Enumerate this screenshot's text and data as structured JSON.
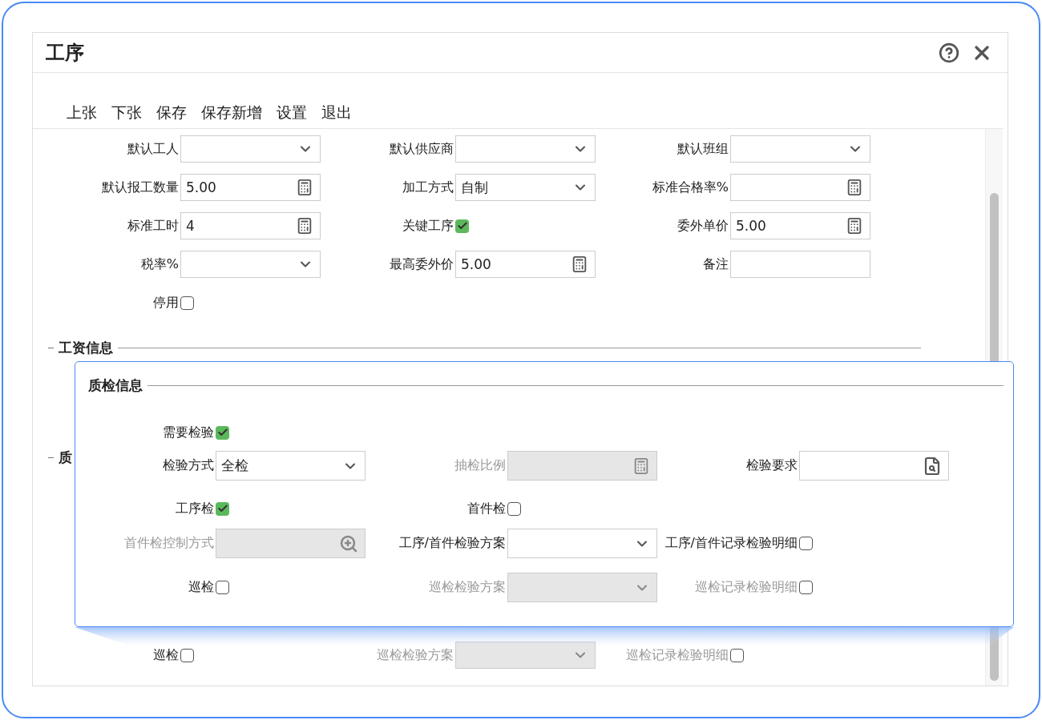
{
  "window": {
    "title": "工序"
  },
  "toolbar": [
    "上张",
    "下张",
    "保存",
    "保存新增",
    "设置",
    "退出"
  ],
  "form": {
    "rows": [
      [
        {
          "label": "默认工人",
          "kind": "select",
          "disabled": false
        },
        {
          "label": "默认供应商",
          "kind": "select",
          "disabled": false
        },
        {
          "label": "默认班组",
          "kind": "select",
          "disabled": false
        }
      ],
      [
        {
          "label": "默认报工数量",
          "kind": "number",
          "value": "5.00",
          "disabled": false
        },
        {
          "label": "加工方式",
          "kind": "select",
          "value": "自制",
          "disabled": false
        },
        {
          "label": "标准合格率%",
          "kind": "number",
          "disabled": false
        }
      ],
      [
        {
          "label": "标准工时",
          "kind": "number",
          "value": "4",
          "disabled": false
        },
        {
          "label": "关键工序",
          "kind": "checkbox",
          "checked": true,
          "disabled": false
        },
        {
          "label": "委外单价",
          "kind": "number",
          "value": "5.00",
          "disabled": false
        }
      ],
      [
        {
          "label": "税率%",
          "kind": "select",
          "disabled": false
        },
        {
          "label": "最高委外价",
          "kind": "number",
          "value": "5.00",
          "disabled": false
        },
        {
          "label": "备注",
          "kind": "text",
          "disabled": false
        }
      ],
      [
        {
          "label": "停用",
          "kind": "checkbox",
          "checked": false,
          "disabled": false
        }
      ]
    ],
    "sections": [
      {
        "title": "工资信息"
      },
      {
        "title": "质"
      }
    ],
    "bottom_row": [
      {
        "label": "巡检",
        "kind": "checkbox",
        "checked": false,
        "disabled": false
      },
      {
        "label": "巡检检验方案",
        "kind": "select",
        "disabled": true
      },
      {
        "label": "巡检记录检验明细",
        "kind": "checkbox",
        "checked": false,
        "disabled": true
      }
    ]
  },
  "callout": {
    "title": "质检信息",
    "rows": [
      [
        {
          "label": "需要检验",
          "kind": "checkbox",
          "checked": true,
          "disabled": false
        }
      ],
      [
        {
          "label": "检验方式",
          "kind": "select",
          "value": "全检",
          "disabled": false
        },
        {
          "label": "抽检比例",
          "kind": "number",
          "disabled": true
        },
        {
          "label": "检验要求",
          "kind": "doc-lookup",
          "disabled": false
        }
      ],
      [
        {
          "label": "工序检",
          "kind": "checkbox",
          "checked": true,
          "disabled": false
        },
        {
          "label": "首件检",
          "kind": "checkbox",
          "checked": false,
          "disabled": false
        }
      ],
      [
        {
          "label": "首件检控制方式",
          "kind": "lookup",
          "disabled": true
        },
        {
          "label": "工序/首件检验方案",
          "kind": "select",
          "disabled": false
        },
        {
          "label": "工序/首件记录检验明细",
          "kind": "checkbox",
          "checked": false,
          "disabled": false
        }
      ],
      [
        {
          "label": "巡检",
          "kind": "checkbox",
          "checked": false,
          "disabled": false
        },
        {
          "label": "巡检检验方案",
          "kind": "select",
          "disabled": true
        },
        {
          "label": "巡检记录检验明细",
          "kind": "checkbox",
          "checked": false,
          "disabled": true
        }
      ]
    ]
  }
}
